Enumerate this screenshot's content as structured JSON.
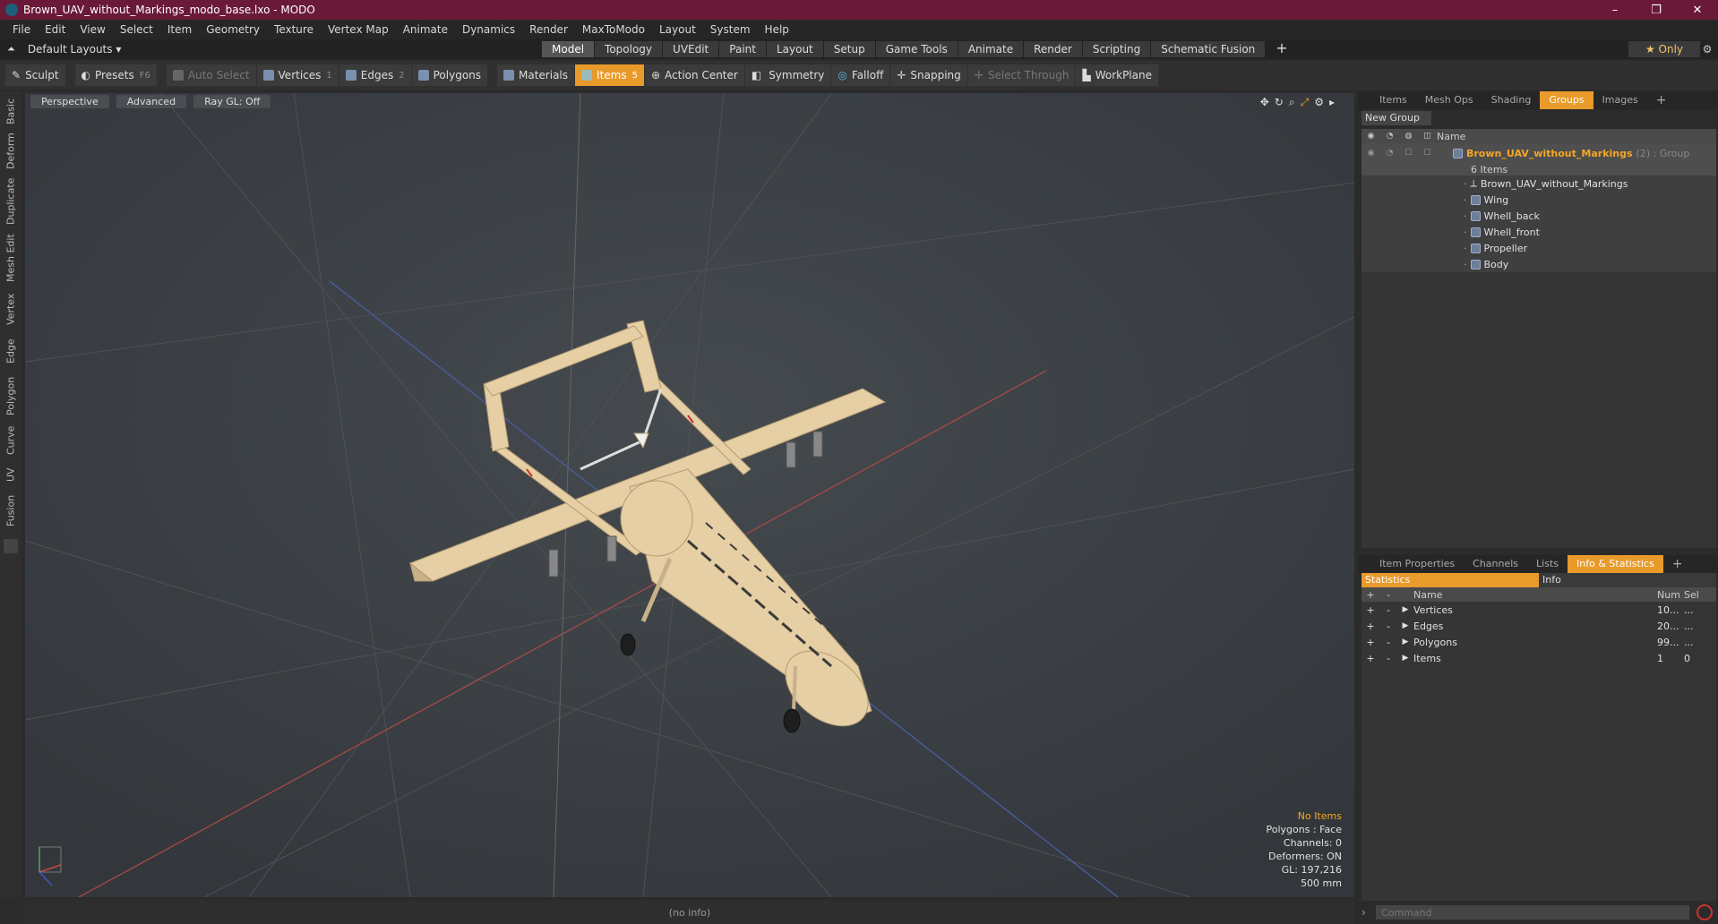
{
  "window": {
    "title": "Brown_UAV_without_Markings_modo_base.lxo - MODO",
    "controls": [
      "–",
      "❐",
      "✕"
    ]
  },
  "menu": [
    "File",
    "Edit",
    "View",
    "Select",
    "Item",
    "Geometry",
    "Texture",
    "Vertex Map",
    "Animate",
    "Dynamics",
    "Render",
    "MaxToModo",
    "Layout",
    "System",
    "Help"
  ],
  "layout": {
    "label": "Default Layouts ▾"
  },
  "mode_tabs": [
    "Model",
    "Topology",
    "UVEdit",
    "Paint",
    "Layout",
    "Setup",
    "Game Tools",
    "Animate",
    "Render",
    "Scripting",
    "Schematic Fusion"
  ],
  "only_label": "★  Only",
  "toolbar": {
    "sculpt": "Sculpt",
    "presets": "Presets",
    "presets_key": "F6",
    "auto_select": "Auto Select",
    "vertices": "Vertices",
    "vertices_key": "1",
    "edges": "Edges",
    "edges_key": "2",
    "polygons": "Polygons",
    "materials": "Materials",
    "items": "Items",
    "items_key": "5",
    "action_center": "Action Center",
    "symmetry": "Symmetry",
    "falloff": "Falloff",
    "snapping": "Snapping",
    "select_through": "Select Through",
    "workplane": "WorkPlane"
  },
  "left_tabs": [
    "Basic",
    "Deform",
    "Duplicate",
    "Mesh Edit",
    "Vertex",
    "Edge",
    "Polygon",
    "Curve",
    "UV",
    "Fusion"
  ],
  "viewport": {
    "view": "Perspective",
    "advanced": "Advanced",
    "raygl": "Ray GL: Off",
    "info": {
      "items": "No Items",
      "polygons": "Polygons : Face",
      "channels": "Channels: 0",
      "deformers": "Deformers: ON",
      "gl": "GL: 197,216",
      "scale": "500 mm"
    }
  },
  "status": "(no info)",
  "panel_top_tabs": [
    "Items",
    "Mesh Ops",
    "Shading",
    "Groups",
    "Images"
  ],
  "new_group": "New Group",
  "groups": {
    "header_name": "Name",
    "group_name": "Brown_UAV_without_Markings",
    "group_suffix": "(2) : Group",
    "count": "6 Items",
    "items": [
      "Brown_UAV_without_Markings",
      "Wing",
      "Whell_back",
      "Whell_front",
      "Propeller",
      "Body"
    ]
  },
  "panel_bottom_tabs": [
    "Item Properties",
    "Channels",
    "Lists",
    "Info & Statistics"
  ],
  "stat_tabs": [
    "Statistics",
    "Info"
  ],
  "stats": {
    "headers": {
      "name": "Name",
      "num": "Num",
      "sel": "Sel"
    },
    "rows": [
      {
        "name": "Vertices",
        "num": "10...",
        "sel": "..."
      },
      {
        "name": "Edges",
        "num": "20...",
        "sel": "..."
      },
      {
        "name": "Polygons",
        "num": "99...",
        "sel": "..."
      },
      {
        "name": "Items",
        "num": "1",
        "sel": "0"
      }
    ]
  },
  "command": {
    "placeholder": "Command"
  },
  "colors": {
    "titlebar": "#6a1a38",
    "accent": "#e89a2a",
    "viewport": "#3a3e42",
    "model": "#e6cfa4"
  }
}
